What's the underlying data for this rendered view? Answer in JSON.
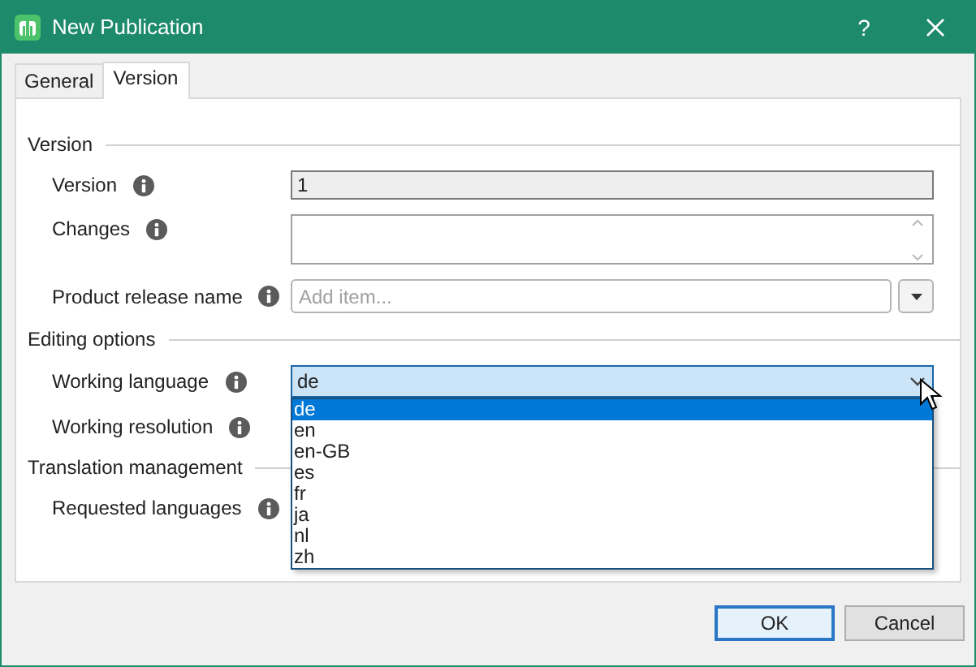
{
  "window": {
    "title": "New Publication",
    "help": "?"
  },
  "tabs": [
    {
      "label": "General",
      "selected": false
    },
    {
      "label": "Version",
      "selected": true
    }
  ],
  "sections": [
    {
      "title": "Version",
      "fields": [
        {
          "label": "Version",
          "kind": "readonly",
          "value": "1"
        },
        {
          "label": "Changes",
          "kind": "multiline"
        },
        {
          "label": "Product release name",
          "kind": "tags",
          "placeholder": "Add item..."
        }
      ]
    },
    {
      "title": "Editing options",
      "fields": [
        {
          "label": "Working language",
          "kind": "combo",
          "value": "de",
          "open": true
        },
        {
          "label": "Working resolution",
          "kind": "covered"
        }
      ]
    },
    {
      "title": "Translation management",
      "fields": [
        {
          "label": "Requested languages",
          "kind": "covered"
        }
      ]
    }
  ],
  "dropdown": {
    "options": [
      {
        "label": "de",
        "selected": true
      },
      {
        "label": "en",
        "selected": false
      },
      {
        "label": "en-GB",
        "selected": false
      },
      {
        "label": "es",
        "selected": false
      },
      {
        "label": "fr",
        "selected": false
      },
      {
        "label": "ja",
        "selected": false
      },
      {
        "label": "nl",
        "selected": false
      },
      {
        "label": "zh",
        "selected": false
      }
    ]
  },
  "buttons": [
    {
      "label": "OK",
      "default": true
    },
    {
      "label": "Cancel",
      "default": false
    }
  ]
}
